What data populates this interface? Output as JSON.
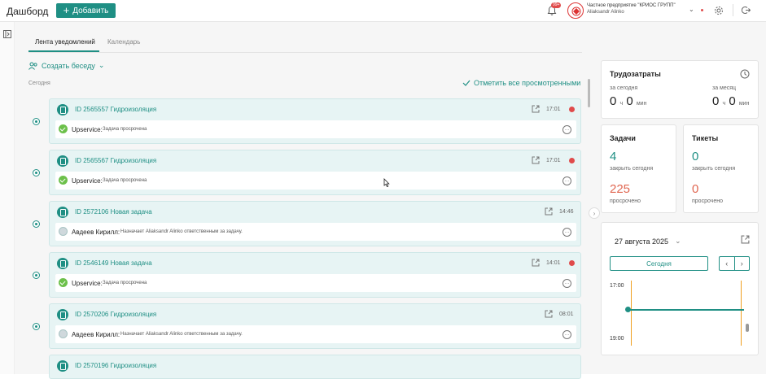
{
  "header": {
    "title": "Дашборд",
    "add_label": "Добавить",
    "notification_badge": "99+",
    "company": "Частное предприятие \"КРИОС ГРУПП\"",
    "user": "Aliaksandr Alinko"
  },
  "tabs": [
    {
      "label": "Лента уведомлений",
      "active": true
    },
    {
      "label": "Календарь",
      "active": false
    }
  ],
  "feed": {
    "create_chat": "Создать беседу",
    "section_label": "Сегодня",
    "mark_all": "Отметить все просмотренными",
    "items": [
      {
        "title": "ID 2565557 Гидроизоляция",
        "time": "17:01",
        "overdue": true,
        "author": "Upservice:",
        "message": "Задача просрочена",
        "kind": "system"
      },
      {
        "title": "ID 2565567 Гидроизоляция",
        "time": "17:01",
        "overdue": true,
        "author": "Upservice:",
        "message": "Задача просрочена",
        "kind": "system"
      },
      {
        "title": "ID 2572106 Новая задача",
        "time": "14:46",
        "overdue": false,
        "author": "Авдеев Кирилл:",
        "message": "Назначает Aliaksandr Alinko ответственным за задачу.",
        "kind": "user"
      },
      {
        "title": "ID 2546149 Новая задача",
        "time": "14:01",
        "overdue": true,
        "author": "Upservice:",
        "message": "Задача просрочена",
        "kind": "system"
      },
      {
        "title": "ID 2570206 Гидроизоляция",
        "time": "08:01",
        "overdue": false,
        "author": "Авдеев Кирилл:",
        "message": "Назначает Aliaksandr Alinko ответственным за задачу.",
        "kind": "user"
      },
      {
        "title": "ID 2570196 Гидроизоляция",
        "time": "",
        "overdue": false,
        "author": "",
        "message": "",
        "kind": "partial"
      }
    ]
  },
  "labor": {
    "title": "Трудозатраты",
    "today_label": "за сегодня",
    "month_label": "за месяц",
    "today_hours": "0",
    "today_minutes": "0",
    "month_hours": "0",
    "month_minutes": "0",
    "hours_unit": "ч",
    "minutes_unit": "мин"
  },
  "tasks": {
    "title": "Задачи",
    "close_today": "4",
    "close_today_label": "закрыть сегодня",
    "overdue": "225",
    "overdue_label": "просрочено"
  },
  "tickets": {
    "title": "Тикеты",
    "close_today": "0",
    "close_today_label": "закрыть сегодня",
    "overdue": "0",
    "overdue_label": "просрочено"
  },
  "calendar": {
    "date": "27 августа 2025",
    "today_label": "Сегодня",
    "hour_1": "17:00",
    "hour_2": "19:00"
  }
}
